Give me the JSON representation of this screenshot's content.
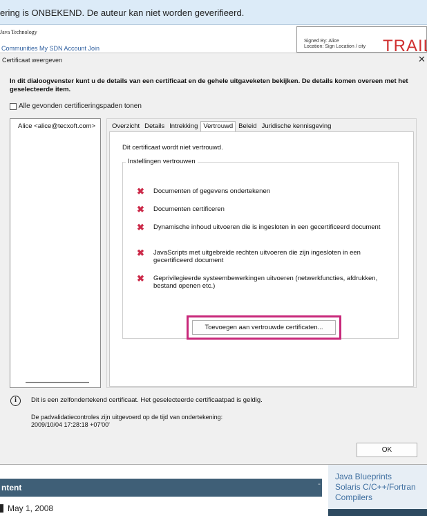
{
  "background": {
    "banner_text": "ering is ONBEKEND. De auteur kan niet worden geverifieerd.",
    "brand_text": "Java Technology",
    "nav_text": "Communities My SDN Account Join",
    "signature": {
      "signed_by": "Signed By: Alice",
      "location": "Location: Sign Location / city",
      "trail_text": "TRAIL"
    },
    "section_title": "ntent",
    "section_dash": "-",
    "date_text": "May 1, 2008",
    "side_text": "Java Blueprints\nSolaris C/C++/Fortran\nCompilers"
  },
  "dialog": {
    "title": "Certificaat weergeven",
    "close_glyph": "✕",
    "description": "In dit dialoogvenster kunt u de details van een certificaat en de gehele uitgaveketen bekijken. De details komen overeen met het geselecteerde item.",
    "show_all_paths_label": "Alle gevonden certificeringspaden tonen",
    "cert_list": [
      "Alice <alice@tecxoft.com>"
    ],
    "tabs": [
      "Overzicht",
      "Details",
      "Intrekking",
      "Vertrouwd",
      "Beleid",
      "Juridische kennisgeving"
    ],
    "active_tab": "Vertrouwd",
    "trust_status": "Dit certificaat wordt niet vertrouwd.",
    "trust_settings_legend": "Instellingen vertrouwen",
    "permissions": [
      {
        "label": "Documenten of gegevens ondertekenen",
        "allowed": false
      },
      {
        "label": "Documenten certificeren",
        "allowed": false
      },
      {
        "label": "Dynamische inhoud uitvoeren die is ingesloten in een gecertificeerd document",
        "allowed": false
      },
      {
        "label": "JavaScripts met uitgebreide rechten uitvoeren die zijn ingesloten in een gecertificeerd document",
        "allowed": false
      },
      {
        "label": "Geprivilegieerde systeembewerkingen uitvoeren (netwerkfuncties, afdrukken, bestand openen etc.)",
        "allowed": false
      }
    ],
    "deny_glyph": "✖",
    "add_trusted_button": "Toevoegen aan vertrouwde certificaten...",
    "highlight_color": "#c8287a",
    "info_icon_glyph": "i",
    "info_line1": "Dit is een zelfondertekend certificaat. Het geselecteerde certificaatpad is geldig.",
    "info_line2": "De padvalidatiecontroles zijn uitgevoerd op de tijd van ondertekening:",
    "info_line3": "2009/10/04 17:28:18 +07'00'",
    "ok_button": "OK"
  }
}
